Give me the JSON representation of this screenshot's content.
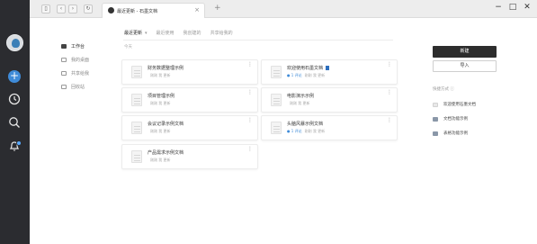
{
  "titlebar": {
    "tab_label": "最近更新 - 石墨文档",
    "tab_close": "×",
    "new_tab": "+",
    "back": "‹",
    "forward": "›",
    "reload": "↻",
    "sidebar_toggle": "▯",
    "minimize": "−",
    "maximize": "□",
    "close": "✕"
  },
  "rail": {
    "plus": "+"
  },
  "subnav": {
    "items": [
      {
        "label": "工作台",
        "active": true
      },
      {
        "label": "我的桌面",
        "active": false
      },
      {
        "label": "共享给我",
        "active": false
      },
      {
        "label": "回收站",
        "active": false
      }
    ]
  },
  "main": {
    "tabs": [
      {
        "label": "最近更新",
        "caret": "▾"
      },
      {
        "label": "最近使用"
      },
      {
        "label": "我创建的"
      },
      {
        "label": "共享给我的"
      }
    ],
    "section": "今天",
    "cards": [
      {
        "title": "财务数据整理示例",
        "meta_blue": "",
        "meta": "刚刚 我 更新",
        "badge": false
      },
      {
        "title": "欢迎使用石墨文档",
        "meta_blue": "● 1 评论",
        "meta": "刚刚 我 更新",
        "badge": true
      },
      {
        "title": "项目管理示例",
        "meta_blue": "",
        "meta": "刚刚 我 更新",
        "badge": false
      },
      {
        "title": "电影演示示例",
        "meta_blue": "",
        "meta": "刚刚 我 更新",
        "badge": false
      },
      {
        "title": "会议记录示例文档",
        "meta_blue": "",
        "meta": "刚刚 我 更新",
        "badge": false
      },
      {
        "title": "头脑风暴示例文档",
        "meta_blue": "● 1 评论",
        "meta": "刚刚 我 更新",
        "badge": false
      },
      {
        "title": "产品需求示例文档",
        "meta_blue": "",
        "meta": "刚刚 我 更新",
        "badge": false
      }
    ],
    "more_glyph": "⋮"
  },
  "right": {
    "new_label": "新建",
    "import_label": "导入",
    "quick_label": "快捷方式 ⓘ",
    "quick_items": [
      {
        "label": "欢迎使用石墨文档",
        "color": "#e8e8e8"
      },
      {
        "label": "文档功能示例",
        "color": "#8a97a8"
      },
      {
        "label": "表格功能示例",
        "color": "#8a97a8"
      }
    ]
  },
  "colors": {
    "rail": "#2b2c30",
    "accent": "#3f8bd8",
    "primary_button": "#2d2d2d"
  }
}
